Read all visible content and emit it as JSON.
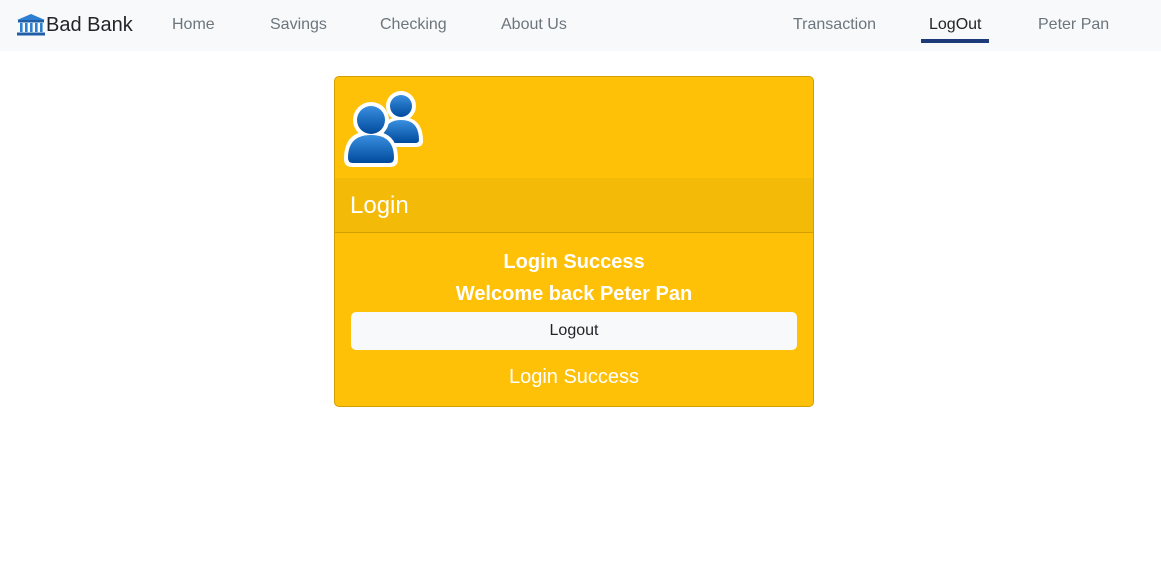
{
  "navbar": {
    "brand_icon": "bank-icon",
    "brand_text": "Bad Bank",
    "links": {
      "home": "Home",
      "savings": "Savings",
      "checking": "Checking",
      "about": "About Us",
      "transaction": "Transaction",
      "logout": "LogOut",
      "user": "Peter Pan"
    },
    "active_link": "LogOut"
  },
  "card": {
    "image_icon": "users-icon",
    "header": "Login",
    "status_title": "Login Success",
    "welcome": "Welcome back Peter Pan",
    "logout_button": "Logout",
    "footer_status": "Login Success"
  },
  "colors": {
    "card_bg": "#ffc107",
    "navbar_bg": "#f8f9fa",
    "active_underline": "#1d3a7a",
    "icon_blue": "#0a66c2"
  }
}
